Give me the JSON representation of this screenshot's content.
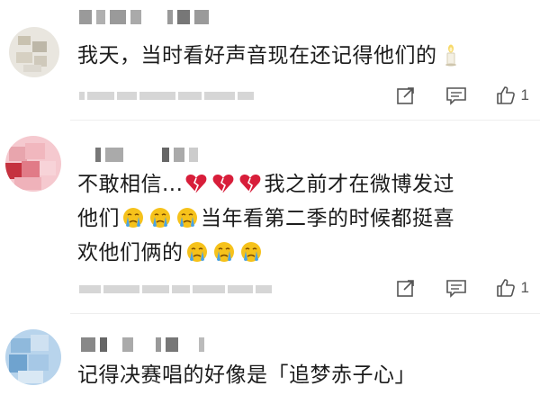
{
  "comments": [
    {
      "text": "我天，当时看好声音现在还记得他们的",
      "emoji_trailing": "candle",
      "like_count": "1"
    },
    {
      "line1_a": "不敢相信...",
      "line1_b": "我之前才在微博发过",
      "line2_a": "他们",
      "line2_b": "当年看第二季的时候都挺喜",
      "line3_a": "欢他们俩的",
      "emoji_heart": "broken-heart",
      "emoji_face": "crying-face",
      "like_count": "1"
    },
    {
      "text": "记得决赛唱的好像是「追梦赤子心」"
    }
  ],
  "icons": {
    "share": "share-icon",
    "comment": "comment-icon",
    "like": "thumbs-up-icon"
  },
  "colors": {
    "text": "#1c1c1c",
    "heart": "#d81e3a",
    "face": "#f6c21b",
    "tear": "#4aa3e6",
    "icon": "#555555"
  }
}
